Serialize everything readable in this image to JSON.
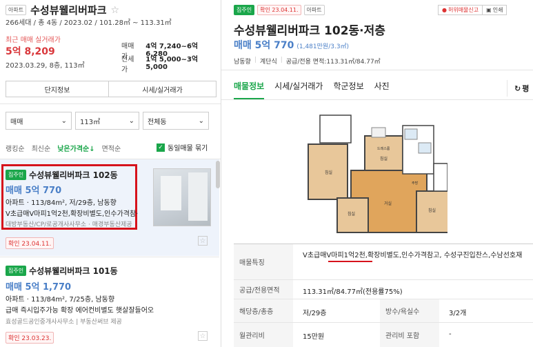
{
  "left": {
    "type_tag": "아파트",
    "complex_name": "수성뷰웰리버파크",
    "complex_info": "266세대 / 총 4동 / 2023.02 / 101.28㎡ ~ 113.31㎡",
    "recent_label": "최근 매매 실거래가",
    "recent_price": "5억 8,209",
    "recent_date": "2023.03.29, 8층, 113㎡",
    "sale_label": "매매가",
    "sale_range": "4억 7,240~6억 6,280",
    "lease_label": "전세가",
    "lease_range": "1억 5,000~3억 5,000",
    "btn_complex": "단지정보",
    "btn_price": "시세/실거래가",
    "filter_type": "매매",
    "filter_area": "113㎡",
    "filter_dong": "전체동",
    "sort_rank": "랭킹순",
    "sort_latest": "최신순",
    "sort_low": "낮은가격순↓",
    "sort_area": "면적순",
    "same_listing": "동일매물 묶기",
    "listings": [
      {
        "tag": "집주인",
        "title": "수성뷰웰리버파크 102동",
        "price": "매매 5억 770",
        "info": "아파트 · 113/84m², 저/29층, 남동향",
        "desc": "V초급매V마피1억2천,확장비별도,인수가격참·",
        "agency": "대방부동산/CP/로공개사사무소 · 매경부동산제공",
        "confirm": "확인 23.04.11."
      },
      {
        "tag": "집주인",
        "title": "수성뷰웰리버파크 101동",
        "price": "매매 5억 1,770",
        "info": "아파트 · 113/84m², 7/25층, 남동향",
        "desc": "급매 즉시입주가능 확장 에어컨비별도 햇살잘들어오",
        "agency": "효성골드공인중개사사무소 | 부동산써브 제공",
        "confirm": "확인 23.03.23."
      }
    ]
  },
  "right": {
    "tag": "집주인",
    "confirm": "확인 23.04.11.",
    "type_tag": "아파트",
    "report_label": "허위매물신고",
    "print_label": "인쇄",
    "title": "수성뷰웰리버파크 102동·저층",
    "price": "매매 5억 770",
    "price_sub": "(1,481만원/3.3㎡)",
    "direction": "남동향",
    "stairs": "계단식",
    "area_info": "공급/전용 면적:113.31㎡/84.77㎡",
    "tabs": [
      "매물정보",
      "시세/실거래가",
      "학군정보",
      "사진"
    ],
    "refresh": "평",
    "rows": [
      {
        "label": "매물특징",
        "value": "V초급매V마피1억2천,확장비별도,인수가격참고, 수성구진입찬스,수남선호재"
      },
      {
        "label": "공급/전용면적",
        "value": "113.31㎡/84.77㎡(전용률75%)"
      },
      {
        "label": "해당층/총층",
        "value": "저/29층",
        "label2": "방수/욕실수",
        "value2": "3/2개"
      },
      {
        "label": "월관리비",
        "value": "15만원",
        "label2": "관리비 포함",
        "value2": "-"
      }
    ],
    "rooms": [
      "침실",
      "드레스룸",
      "침실",
      "거실",
      "침실",
      "침실",
      "주방"
    ]
  },
  "colors": {
    "green": "#1aa64a",
    "blue": "#4a7fc7",
    "red": "#d9373b",
    "highlight": "#d6121b"
  }
}
